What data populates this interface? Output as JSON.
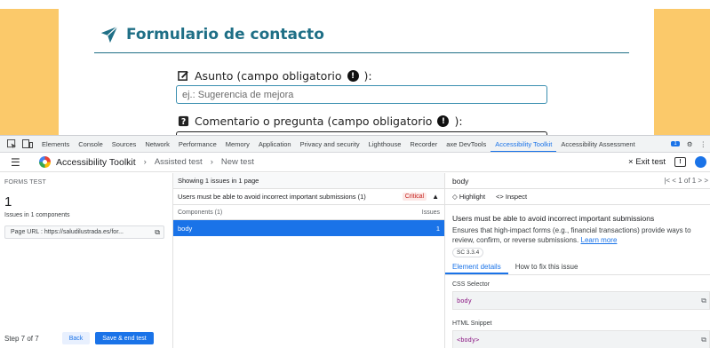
{
  "page": {
    "title": "Formulario de contacto",
    "field1": {
      "label": "Asunto (campo obligatorio",
      "suffix": "):",
      "placeholder": "ej.: Sugerencia de mejora"
    },
    "field2": {
      "label": "Comentario o pregunta (campo obligatorio",
      "suffix": "):"
    }
  },
  "devtools": {
    "tabs": [
      "Elements",
      "Console",
      "Sources",
      "Network",
      "Performance",
      "Memory",
      "Application",
      "Privacy and security",
      "Lighthouse",
      "Recorder",
      "axe DevTools",
      "Accessibility Toolkit",
      "Accessibility Assessment"
    ],
    "active_tab": "Accessibility Toolkit",
    "issue_badge": "1"
  },
  "breadcrumb": {
    "app": "Accessibility Toolkit",
    "step": "Assisted test",
    "current": "New test",
    "exit": "× Exit test"
  },
  "left": {
    "heading": "FORMS TEST",
    "count": "1",
    "sub": "Issues in 1 components",
    "url": "Page URL : https://saludilustrada.es/for...",
    "step": "Step 7 of 7",
    "back": "Back",
    "save": "Save & end test"
  },
  "middle": {
    "header": "Showing 1 issues in 1 page",
    "issue": "Users must be able to avoid incorrect important submissions (1)",
    "severity": "Critical",
    "components_label": "Components (1)",
    "issues_label": "Issues",
    "component": "body",
    "component_count": "1"
  },
  "right": {
    "element": "body",
    "pager": "|<  < 1 of 1 >  >",
    "highlight": "Highlight",
    "inspect": "<> Inspect",
    "title": "Users must be able to avoid incorrect important submissions",
    "desc": "Ensures that high-impact forms (e.g., financial transactions) provide ways to review, confirm, or reverse submissions.",
    "learn_more": "Learn more",
    "sc": "SC 3.3.4",
    "tab_details": "Element details",
    "tab_fix": "How to fix this issue",
    "css_label": "CSS Selector",
    "css_value": "body",
    "html_label": "HTML Snippet",
    "html_value": "<body>"
  },
  "colors": {
    "accent": "#1a73e8",
    "brand": "#1f6f86",
    "sidebar": "#fbc96a",
    "critical": "#c5221f"
  }
}
